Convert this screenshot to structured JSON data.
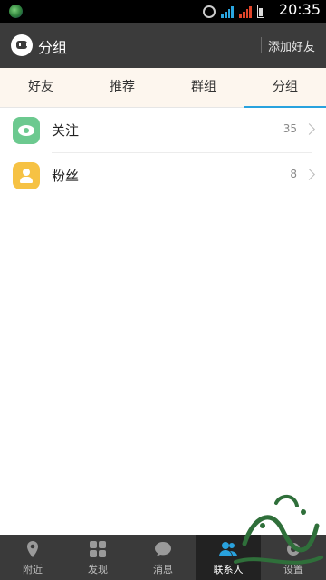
{
  "status_bar": {
    "time": "20:35"
  },
  "header": {
    "title": "分组",
    "add_friend": "添加好友"
  },
  "tabs": [
    {
      "label": "好友",
      "active": false
    },
    {
      "label": "推荐",
      "active": false
    },
    {
      "label": "群组",
      "active": false
    },
    {
      "label": "分组",
      "active": true
    }
  ],
  "groups": [
    {
      "label": "关注",
      "count": "35",
      "icon": "eye-icon",
      "color": "#6cc98f"
    },
    {
      "label": "粉丝",
      "count": "8",
      "icon": "person-icon",
      "color": "#f6c244"
    }
  ],
  "bottom_nav": [
    {
      "label": "附近",
      "icon": "location-pin-icon",
      "active": false
    },
    {
      "label": "发现",
      "icon": "grid-icon",
      "active": false
    },
    {
      "label": "消息",
      "icon": "chat-bubble-icon",
      "active": false
    },
    {
      "label": "联系人",
      "icon": "contacts-icon",
      "active": true
    },
    {
      "label": "设置",
      "icon": "gear-icon",
      "active": false
    }
  ],
  "colors": {
    "accent": "#29a2de",
    "title_bar": "#3b3b3b",
    "nav_bar": "#3a3a3a"
  }
}
